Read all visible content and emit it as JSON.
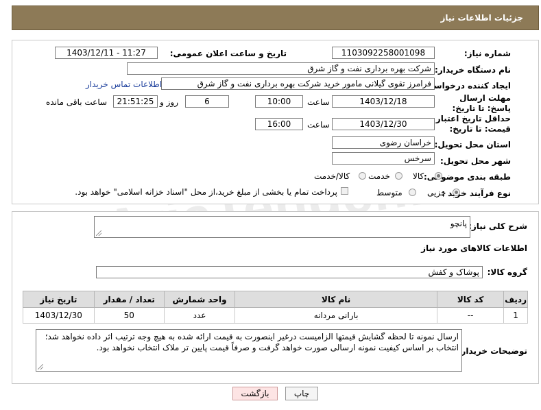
{
  "header": {
    "title": "جزئیات اطلاعات نیاز"
  },
  "form": {
    "need_number_label": "شماره نیاز:",
    "need_number": "1103092258001098",
    "announce_label": "تاریخ و ساعت اعلان عمومی:",
    "announce_value": "1403/12/11 - 11:27",
    "buyer_org_label": "نام دستگاه خریدار:",
    "buyer_org": "شرکت بهره برداری نفت و گاز شرق",
    "creator_label": "ایجاد کننده درخواست:",
    "creator": "فرامرز تقوی گیلانی مامور خرید شرکت بهره برداری نفت و گاز شرق",
    "contact_link": "اطلاعات تماس خریدار",
    "deadline_label": "مهلت ارسال پاسخ: تا تاریخ:",
    "deadline_date": "1403/12/18",
    "time_label": "ساعت",
    "deadline_time": "10:00",
    "days_value": "6",
    "days_label": "روز و",
    "remaining_time": "21:51:25",
    "remaining_label": "ساعت باقی مانده",
    "validity_label": "حداقل تاریخ اعتبار قیمت: تا تاریخ:",
    "validity_date": "1403/12/30",
    "validity_time_label": "ساعت",
    "validity_time": "16:00",
    "province_label": "استان محل تحویل:",
    "province": "خراسان رضوی",
    "city_label": "شهر محل تحویل:",
    "city": "سرخس",
    "category_label": "طبقه بندی موضوعی:",
    "category_options": [
      "کالا",
      "خدمت",
      "کالا/خدمت"
    ],
    "process_label": "نوع فرآیند خرید :",
    "process_options": [
      "جزیی",
      "متوسط"
    ],
    "payment_note": "پرداخت تمام یا بخشی از مبلغ خرید،از محل \"اسناد خزانه اسلامی\" خواهد بود."
  },
  "description": {
    "label": "شرح کلی نیاز:",
    "value": "پانچو"
  },
  "goods": {
    "section_title": "اطلاعات کالاهای مورد نیاز",
    "group_label": "گروه کالا:",
    "group_value": "پوشاک و کفش",
    "columns": [
      "ردیف",
      "کد کالا",
      "نام کالا",
      "واحد شمارش",
      "تعداد / مقدار",
      "تاریخ نیاز"
    ],
    "rows": [
      [
        "1",
        "--",
        "بارانی مردانه",
        "عدد",
        "50",
        "1403/12/30"
      ]
    ]
  },
  "buyer_notes": {
    "label": "توضیحات خریدار:",
    "value": "ارسال نمونه تا لحظه گشایش قیمتها الزامیست درغیر اینصورت به قیمت ارائه شده به هیچ وجه ترتیب اثر داده نخواهد شد؛ انتخاب بر اساس کیفیت نمونه ارسالی صورت خواهد گرفت و صرفاً قیمت پایین تر ملاک انتخاب نخواهد بود."
  },
  "buttons": {
    "print": "چاپ",
    "back": "بازگشت"
  },
  "watermark": "AriaTender.net",
  "colors": {
    "header_bg": "#8d7a57",
    "link": "#1a3d9b",
    "back_button_bg": "#fde4e4"
  }
}
